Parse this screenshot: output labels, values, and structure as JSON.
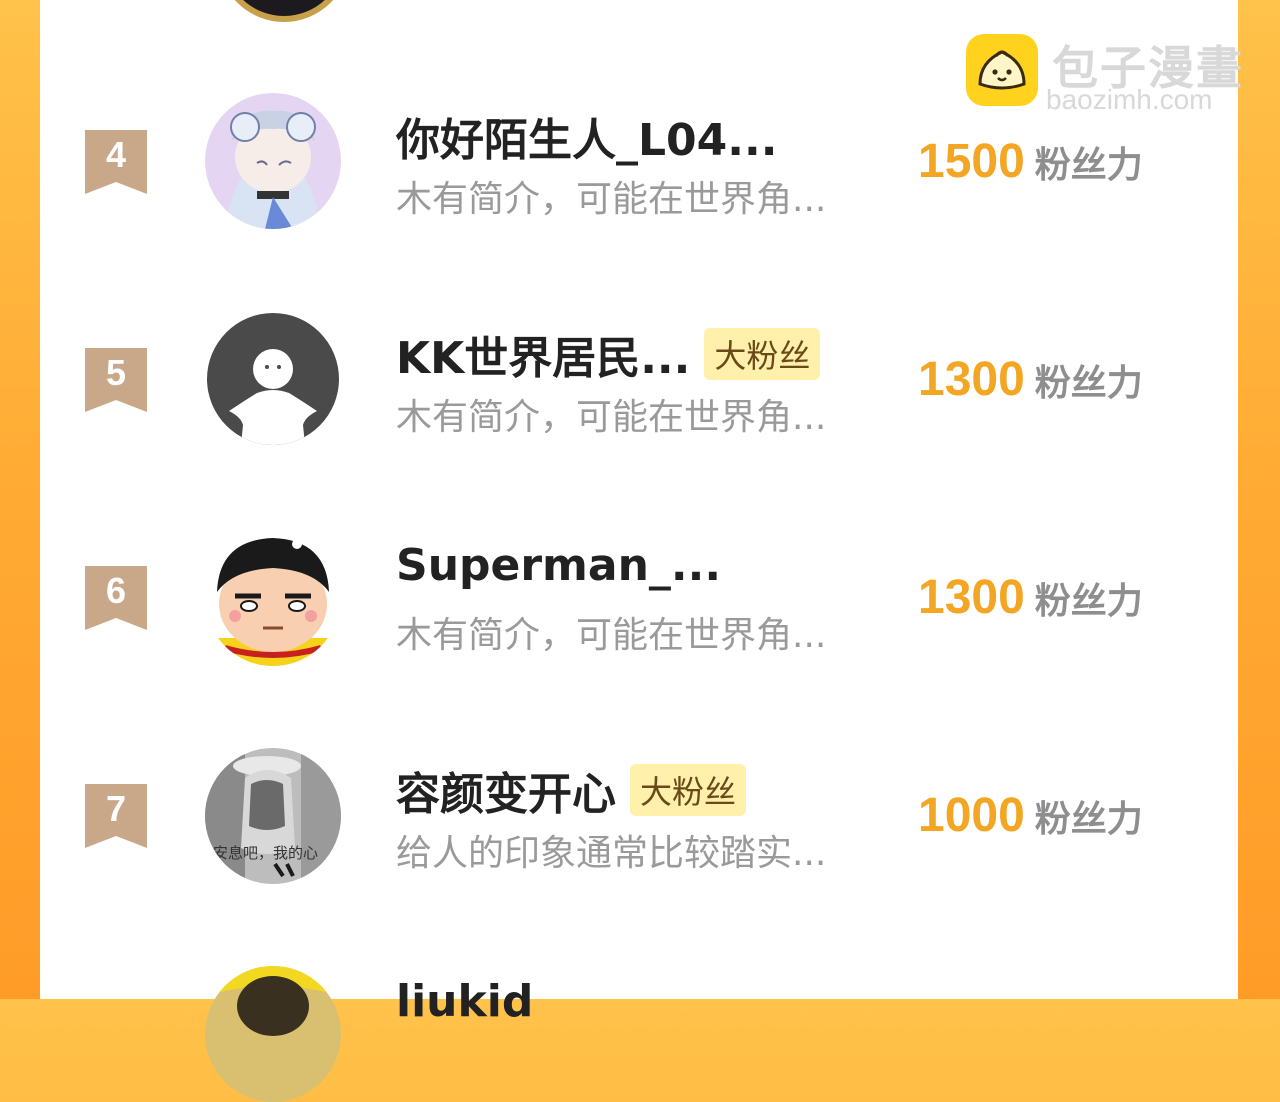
{
  "watermark": {
    "title": "包子漫畫",
    "url": "baozimh.com"
  },
  "fans": [
    {
      "rank": "4",
      "name": "你好陌生人_L04...",
      "badge": "",
      "bio": "木有简介，可能在世界角...",
      "score": "1500",
      "unit": "粉丝力",
      "avatar": "anime-girl-avatar"
    },
    {
      "rank": "5",
      "name": "KK世界居民...",
      "badge": "大粉丝",
      "bio": "木有简介，可能在世界角...",
      "score": "1300",
      "unit": "粉丝力",
      "avatar": "default-avatar"
    },
    {
      "rank": "6",
      "name": "Superman_...",
      "badge": "",
      "bio": "木有简介，可能在世界角...",
      "score": "1300",
      "unit": "粉丝力",
      "avatar": "cartoon-boy-avatar"
    },
    {
      "rank": "7",
      "name": "容颜变开心",
      "badge": "大粉丝",
      "bio": "给人的印象通常比较踏实...",
      "score": "1000",
      "unit": "粉丝力",
      "avatar": "photo-avatar",
      "avatar_caption": "安息吧，我的心"
    },
    {
      "rank": "",
      "name": "liukid",
      "badge": "",
      "bio": "",
      "score": "",
      "unit": "",
      "avatar": "partial-avatar"
    }
  ],
  "colors": {
    "accent": "#f2a624",
    "badge_bg": "#fff1ab",
    "rank_flag": "#c8a888",
    "frame": "#ffaa33"
  }
}
